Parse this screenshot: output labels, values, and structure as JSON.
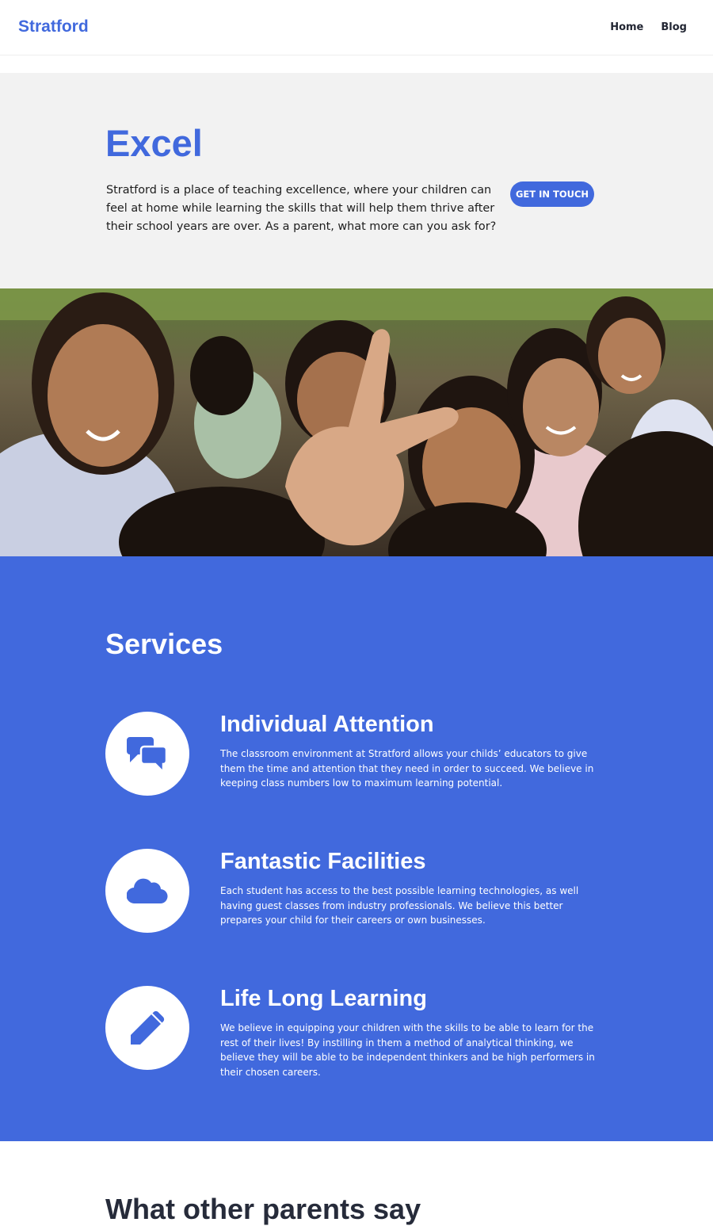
{
  "header": {
    "logo": "Stratford",
    "nav": [
      "Home",
      "Blog"
    ]
  },
  "hero": {
    "title": "Excel",
    "text": "Stratford is a place of teaching excellence, where your children can feel at home while learning the skills that will help them thrive after their school years are over. As a parent, what more can you ask for?",
    "button": "GET IN TOUCH"
  },
  "photo": {
    "subject": "group of smiling schoolchildren, one making a peace sign"
  },
  "services": {
    "title": "Services",
    "items": [
      {
        "icon": "chat-bubbles-icon",
        "title": "Individual Attention",
        "text": "The classroom environment at Stratford allows your childs’ educators to give them the time and attention that they need in order to succeed. We believe in keeping class numbers low to maximum learning potential."
      },
      {
        "icon": "cloud-icon",
        "title": "Fantastic Facilities",
        "text": "Each student has access to the best possible learning technologies, as well having guest classes from industry professionals. We believe this better prepares your child for their careers or own businesses."
      },
      {
        "icon": "pencil-icon",
        "title": "Life Long Learning",
        "text": "We believe in equipping your children with the skills to be able to learn for the rest of their lives! By instilling in them a method of analytical thinking, we believe they will be able to be independent thinkers and be high performers in their chosen careers."
      }
    ]
  },
  "testimonials": {
    "title": "What other parents say"
  },
  "colors": {
    "brand": "#4169dd",
    "hero_bg": "#f2f2f2",
    "text_dark": "#262b3a"
  }
}
